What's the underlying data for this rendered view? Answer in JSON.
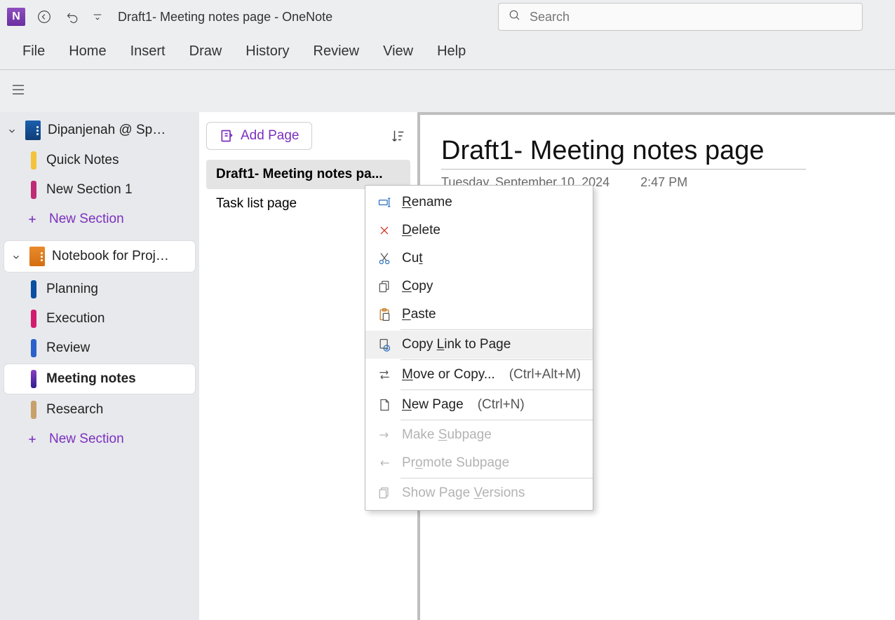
{
  "app": {
    "name_letter": "N",
    "window_title": "Draft1- Meeting notes page  -  OneNote",
    "search_placeholder": "Search"
  },
  "menu": [
    "File",
    "Home",
    "Insert",
    "Draw",
    "History",
    "Review",
    "View",
    "Help"
  ],
  "sidebar": {
    "notebooks": [
      {
        "title": "Dipanjenah @ Spiral...",
        "sections": [
          {
            "label": "Quick Notes",
            "color": "c-yellow"
          },
          {
            "label": "New Section 1",
            "color": "c-pink"
          }
        ],
        "new_section_label": "New Section"
      },
      {
        "title": "Notebook for Project A",
        "sections": [
          {
            "label": "Planning",
            "color": "c-blue"
          },
          {
            "label": "Execution",
            "color": "c-magenta"
          },
          {
            "label": "Review",
            "color": "c-blue2"
          },
          {
            "label": "Meeting notes",
            "color": "active",
            "active": true
          },
          {
            "label": "Research",
            "color": "c-tan"
          }
        ],
        "new_section_label": "New Section"
      }
    ]
  },
  "pages": {
    "add_label": "Add Page",
    "items": [
      {
        "label": "Draft1- Meeting notes pa...",
        "active": true
      },
      {
        "label": "Task list page"
      }
    ]
  },
  "canvas": {
    "title": "Draft1- Meeting notes page",
    "date": "Tuesday, September 10, 2024",
    "time": "2:47 PM"
  },
  "context_menu": {
    "items": [
      {
        "icon": "rename",
        "label": "Rename",
        "u": "R"
      },
      {
        "icon": "delete",
        "label": "Delete",
        "u": "D"
      },
      {
        "icon": "cut",
        "label": "Cut",
        "u": "t"
      },
      {
        "icon": "copy",
        "label": "Copy",
        "u": "C"
      },
      {
        "icon": "paste",
        "label": "Paste",
        "u": "P"
      },
      {
        "sep": true
      },
      {
        "icon": "link",
        "label": "Copy Link to Page",
        "u": "L",
        "hover": true
      },
      {
        "sep": true
      },
      {
        "icon": "move",
        "label": "Move or Copy...",
        "u": "M",
        "shortcut": "(Ctrl+Alt+M)"
      },
      {
        "sep": true
      },
      {
        "icon": "newpage",
        "label": "New Page",
        "u": "N",
        "shortcut": "(Ctrl+N)"
      },
      {
        "sep": true
      },
      {
        "icon": "subright",
        "label": "Make Subpage",
        "u": "S",
        "disabled": true
      },
      {
        "icon": "subleft",
        "label": "Promote Subpage",
        "u": "o",
        "disabled": true
      },
      {
        "sep": true
      },
      {
        "icon": "versions",
        "label": "Show Page Versions",
        "u": "V",
        "disabled": true
      }
    ]
  }
}
